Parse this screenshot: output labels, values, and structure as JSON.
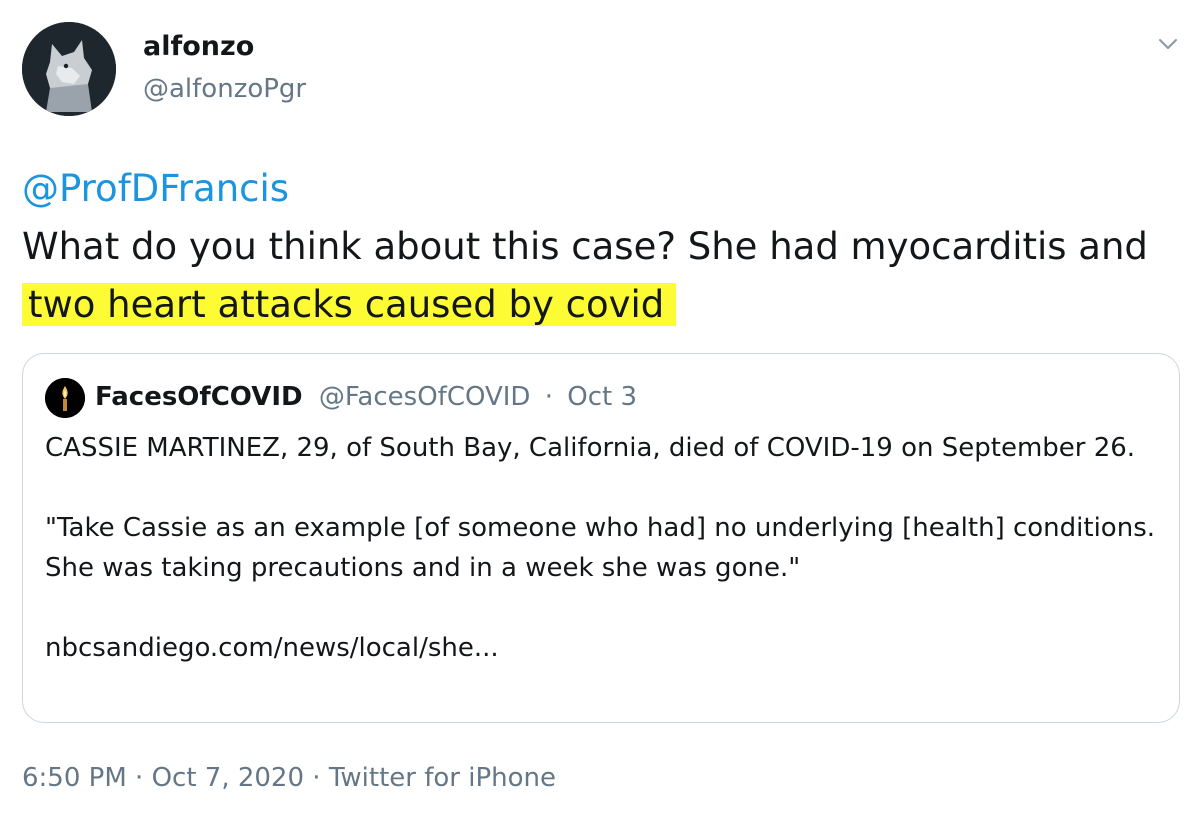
{
  "author": {
    "display_name": "alfonzo",
    "handle": "@alfonzoPgr"
  },
  "tweet": {
    "mention": "@ProfDFrancis",
    "text_before_highlight": "What do you think about this case? She had myocarditis and",
    "text_highlighted": "two heart attacks caused by covid",
    "highlight_color": "#fdfc34"
  },
  "quoted_tweet": {
    "display_name": "FacesOfCOVID",
    "handle": "@FacesOfCOVID",
    "separator": "·",
    "date": "Oct 3",
    "paragraph_1": "CASSIE MARTINEZ, 29, of South Bay, California, died of COVID-19 on September 26.",
    "paragraph_2": "\"Take Cassie as an example [of someone who had] no underlying [health] conditions. She was taking precautions and in a week she was gone.\"",
    "link": "nbcsandiego.com/news/local/she..."
  },
  "footer": {
    "time": "6:50 PM",
    "separator_1": "·",
    "date": "Oct 7, 2020",
    "separator_2": "·",
    "source": "Twitter for iPhone"
  },
  "icons": {
    "menu": "chevron-down-icon",
    "quoted_avatar": "candle-icon"
  },
  "colors": {
    "link": "#1b95e0",
    "secondary_text": "#657786",
    "primary_text": "#14171a",
    "border": "#ccd6dd"
  }
}
